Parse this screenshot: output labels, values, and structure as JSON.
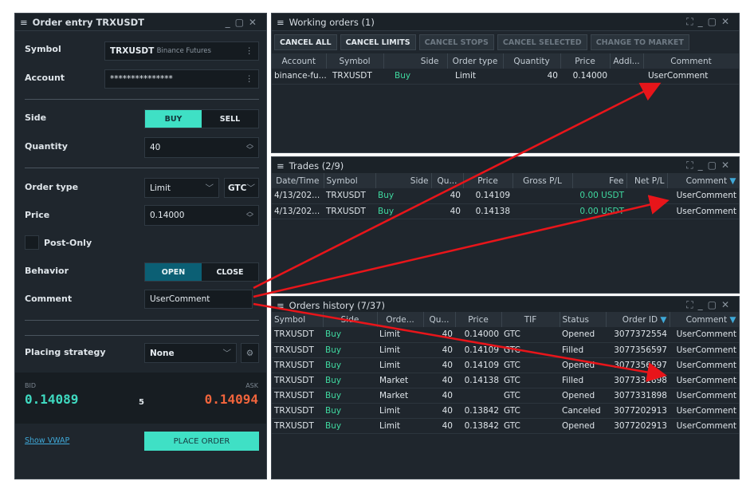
{
  "order_entry": {
    "title": "Order entry TRXUSDT",
    "symbol_label": "Symbol",
    "symbol_value": "TRXUSDT",
    "symbol_exchange": "Binance Futures",
    "account_label": "Account",
    "account_value": "***************",
    "side_label": "Side",
    "buy": "BUY",
    "sell": "SELL",
    "quantity_label": "Quantity",
    "quantity_value": "40",
    "order_type_label": "Order type",
    "order_type_value": "Limit",
    "tif_value": "GTC",
    "price_label": "Price",
    "price_value": "0.14000",
    "post_only_label": "Post-Only",
    "behavior_label": "Behavior",
    "open": "OPEN",
    "close": "CLOSE",
    "comment_label": "Comment",
    "comment_value": "UserComment",
    "placing_label": "Placing strategy",
    "placing_value": "None",
    "bid_label": "BID",
    "bid_value": "0.14089",
    "spread": "5",
    "ask_label": "ASK",
    "ask_value": "0.14094",
    "vwap_link": "Show VWAP",
    "place_order": "PLACE ORDER"
  },
  "working": {
    "title": "Working orders (1)",
    "buttons": [
      "CANCEL ALL",
      "CANCEL LIMITS",
      "CANCEL STOPS",
      "CANCEL SELECTED",
      "CHANGE TO MARKET"
    ],
    "headers": [
      "Account",
      "Symbol",
      "Side",
      "Order type",
      "Quantity",
      "Price",
      "Addi...",
      "Comment"
    ],
    "rows": [
      [
        "binance-fu...",
        "TRXUSDT",
        "Buy",
        "Limit",
        "40",
        "0.14000",
        "",
        "UserComment"
      ]
    ]
  },
  "trades": {
    "title": "Trades (2/9)",
    "headers": [
      "Date/Time",
      "Symbol",
      "Side",
      "Qu...",
      "Price",
      "Gross P/L",
      "Fee",
      "Net P/L",
      "Comment"
    ],
    "rows": [
      [
        "4/13/202...",
        "TRXUSDT",
        "Buy",
        "40",
        "0.14109",
        "",
        "0.00 USDT",
        "",
        "UserComment"
      ],
      [
        "4/13/202...",
        "TRXUSDT",
        "Buy",
        "40",
        "0.14138",
        "",
        "0.00 USDT",
        "",
        "UserComment"
      ]
    ]
  },
  "history": {
    "title": "Orders history (7/37)",
    "headers": [
      "Symbol",
      "Side",
      "Orde...",
      "Qu...",
      "Price",
      "TIF",
      "Status",
      "Order ID",
      "Comment"
    ],
    "rows": [
      [
        "TRXUSDT",
        "Buy",
        "Limit",
        "40",
        "0.14000",
        "GTC",
        "Opened",
        "3077372554",
        "UserComment"
      ],
      [
        "TRXUSDT",
        "Buy",
        "Limit",
        "40",
        "0.14109",
        "GTC",
        "Filled",
        "3077356597",
        "UserComment"
      ],
      [
        "TRXUSDT",
        "Buy",
        "Limit",
        "40",
        "0.14109",
        "GTC",
        "Opened",
        "3077356597",
        "UserComment"
      ],
      [
        "TRXUSDT",
        "Buy",
        "Market",
        "40",
        "0.14138",
        "GTC",
        "Filled",
        "3077331898",
        "UserComment"
      ],
      [
        "TRXUSDT",
        "Buy",
        "Market",
        "40",
        "",
        "GTC",
        "Opened",
        "3077331898",
        "UserComment"
      ],
      [
        "TRXUSDT",
        "Buy",
        "Limit",
        "40",
        "0.13842",
        "GTC",
        "Canceled",
        "3077202913",
        "UserComment"
      ],
      [
        "TRXUSDT",
        "Buy",
        "Limit",
        "40",
        "0.13842",
        "GTC",
        "Opened",
        "3077202913",
        "UserComment"
      ]
    ]
  },
  "colors": {
    "accent": "#3fe0c5",
    "buy": "#3fd9a0",
    "ask": "#f0643c",
    "arrow": "#e8151a"
  }
}
